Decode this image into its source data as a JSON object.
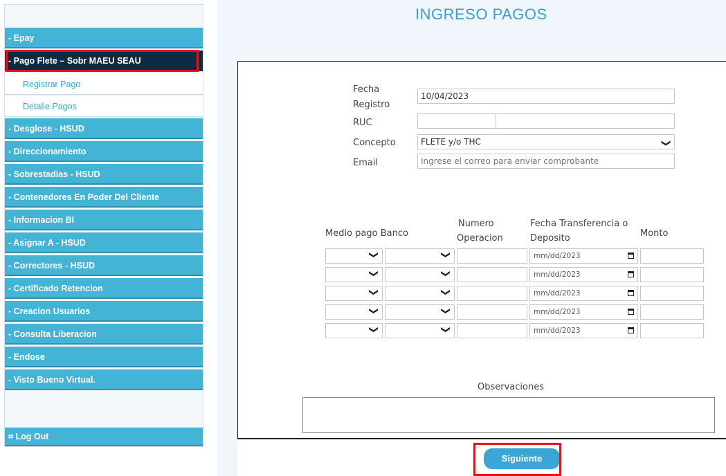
{
  "page": {
    "title": "INGRESO PAGOS"
  },
  "sidebar": {
    "items": [
      {
        "label": "- Epay"
      },
      {
        "label": "- Pago Flete – Sobr MAEU SEAU",
        "active": true
      },
      {
        "label": "Registrar Pago",
        "sub": true
      },
      {
        "label": "Detalle Pagos",
        "sub": true
      },
      {
        "label": "- Desglose - HSUD"
      },
      {
        "label": "- Direccionamiento"
      },
      {
        "label": "- Sobrestadias - HSUD"
      },
      {
        "label": "- Contenedores En Poder Del Cliente"
      },
      {
        "label": "- Informacion BI"
      },
      {
        "label": "- Asignar A - HSUD"
      },
      {
        "label": "- Correctores - HSUD"
      },
      {
        "label": "- Certificado Retencion"
      },
      {
        "label": "- Creacion Usuarios"
      },
      {
        "label": "- Consulta Liberacion"
      },
      {
        "label": "- Endose"
      },
      {
        "label": "- Visto Bueno Virtual."
      }
    ],
    "logout": "⌗ Log Out"
  },
  "form": {
    "fecha_registro": {
      "label_line1": "Fecha",
      "label_line2": "Registro",
      "value": "10/04/2023"
    },
    "ruc": {
      "label": "RUC",
      "value": ""
    },
    "concepto": {
      "label": "Concepto",
      "value": "FLETE y/o THC"
    },
    "email": {
      "label": "Email",
      "placeholder": "Ingrese el correo para enviar comprobante"
    }
  },
  "payments": {
    "headers": {
      "medio_banco": "Medio pago Banco",
      "numero_1": "Numero",
      "numero_2": "Operacion",
      "fecha_1": "Fecha Transferencia o",
      "fecha_2": "Deposito",
      "monto": "Monto"
    },
    "date_placeholder": "mm/dd/2023",
    "rows": 5
  },
  "observaciones": {
    "label": "Observaciones"
  },
  "actions": {
    "next": "Siguiente"
  },
  "colors": {
    "accent": "#44b4d6",
    "active": "#0f2b44",
    "highlight": "#e4141b",
    "title": "#3a9fd0"
  }
}
